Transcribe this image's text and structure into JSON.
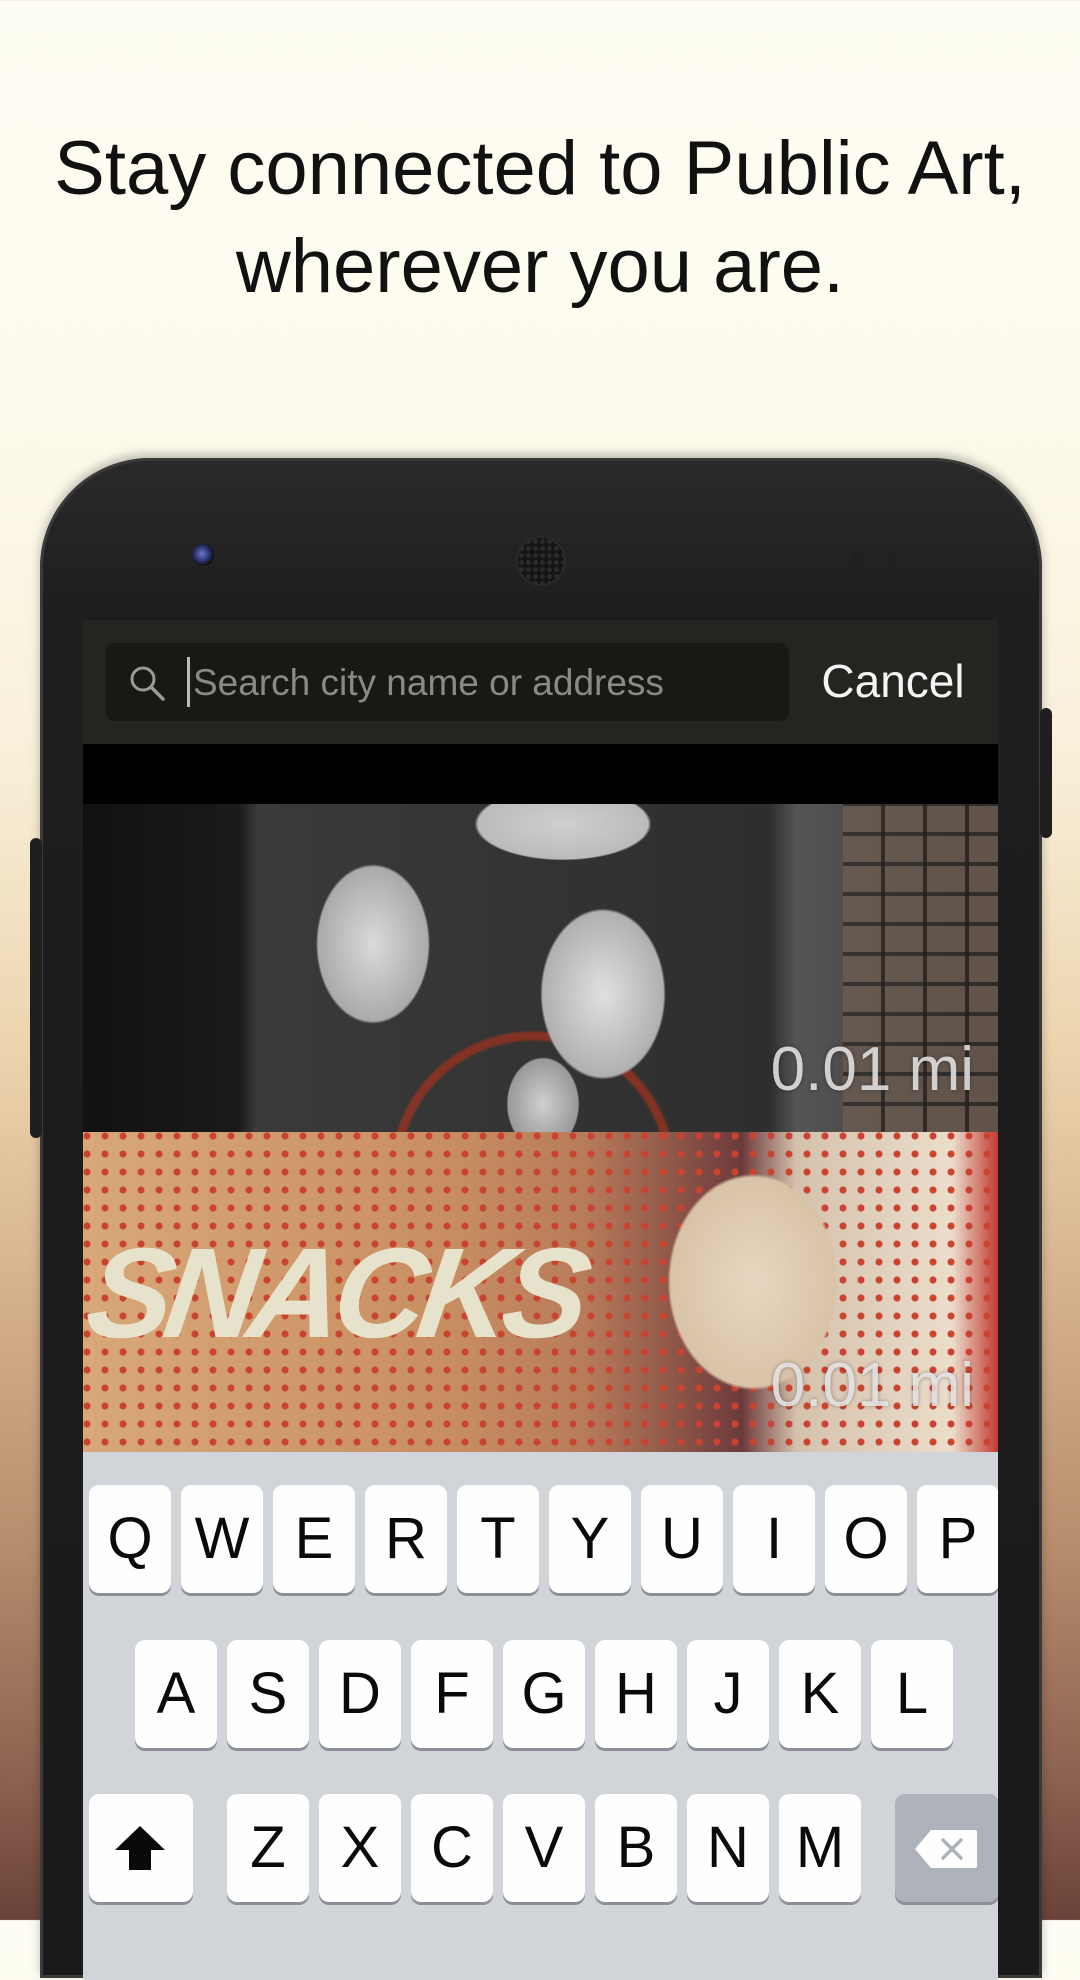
{
  "headline": {
    "line1": "Stay connected to Public Art,",
    "line2": "wherever you are."
  },
  "search": {
    "placeholder": "Search city name or address",
    "value": "",
    "cancel_label": "Cancel"
  },
  "results": [
    {
      "distance": "0.01 mi"
    },
    {
      "distance": "0.01 mi",
      "artwork_text": "SNACKS"
    }
  ],
  "keyboard": {
    "row1": [
      "Q",
      "W",
      "E",
      "R",
      "T",
      "Y",
      "U",
      "I",
      "O",
      "P"
    ],
    "row2": [
      "A",
      "S",
      "D",
      "F",
      "G",
      "H",
      "J",
      "K",
      "L"
    ],
    "row3": [
      "Z",
      "X",
      "C",
      "V",
      "B",
      "N",
      "M"
    ]
  },
  "icons": {
    "search": "search-icon",
    "shift": "shift-icon",
    "delete": "delete-icon"
  },
  "colors": {
    "search_bar_bg": "#242420",
    "keyboard_bg": "#d1d5da",
    "special_key_bg": "#aeb3bb"
  }
}
